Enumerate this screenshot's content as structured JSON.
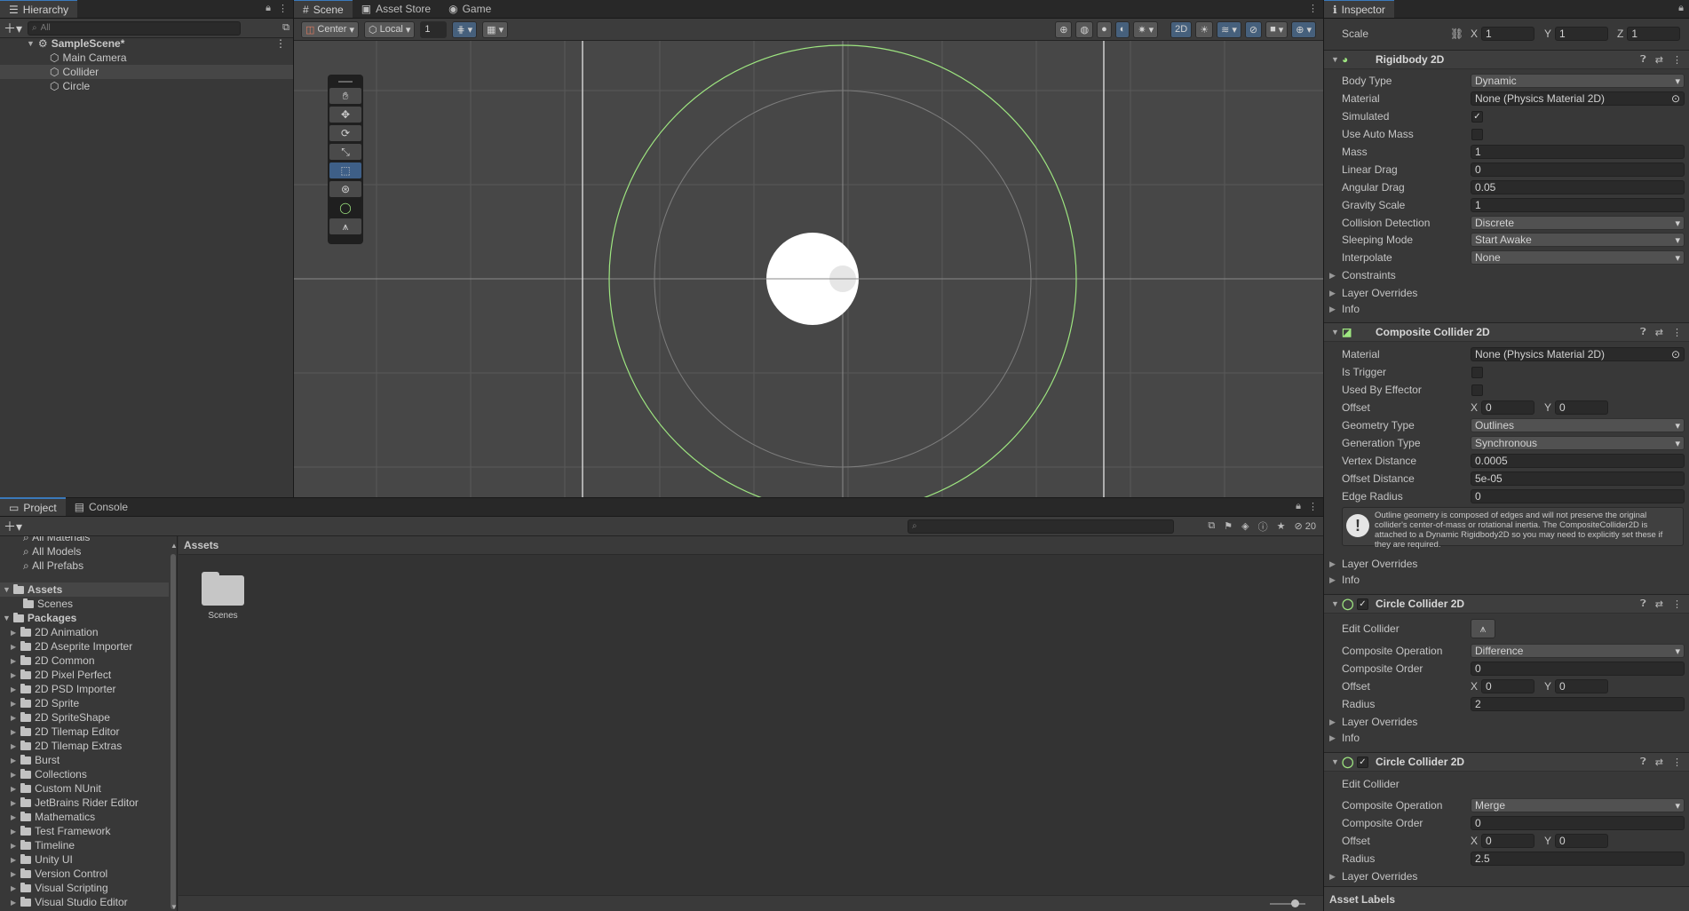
{
  "colors": {
    "accent": "#3a79bb",
    "selection": "#3e5f87",
    "collider_green": "#9ee680",
    "bg": "#383838"
  },
  "hierarchy": {
    "tab": "Hierarchy",
    "search_placeholder": "All",
    "scene_name": "SampleScene*",
    "items": [
      "Main Camera",
      "Collider",
      "Circle"
    ]
  },
  "scene_tabs": {
    "scene": "Scene",
    "asset_store": "Asset Store",
    "game": "Game"
  },
  "scene_toolbar": {
    "pivot": "Center",
    "space": "Local",
    "snap_value": "1",
    "mode_2d": "2D"
  },
  "inspector": {
    "tab": "Inspector",
    "scale": {
      "label": "Scale",
      "x": "1",
      "y": "1",
      "z": "1"
    },
    "rigidbody": {
      "title": "Rigidbody 2D",
      "body_type_label": "Body Type",
      "body_type": "Dynamic",
      "material_label": "Material",
      "material": "None (Physics Material 2D)",
      "simulated_label": "Simulated",
      "use_auto_mass_label": "Use Auto Mass",
      "mass_label": "Mass",
      "mass": "1",
      "linear_drag_label": "Linear Drag",
      "linear_drag": "0",
      "angular_drag_label": "Angular Drag",
      "angular_drag": "0.05",
      "gravity_scale_label": "Gravity Scale",
      "gravity_scale": "1",
      "collision_detection_label": "Collision Detection",
      "collision_detection": "Discrete",
      "sleeping_mode_label": "Sleeping Mode",
      "sleeping_mode": "Start Awake",
      "interpolate_label": "Interpolate",
      "interpolate": "None",
      "constraints": "Constraints",
      "layer_overrides": "Layer Overrides",
      "info": "Info"
    },
    "composite": {
      "title": "Composite Collider 2D",
      "material_label": "Material",
      "material": "None (Physics Material 2D)",
      "is_trigger_label": "Is Trigger",
      "used_by_effector_label": "Used By Effector",
      "offset_label": "Offset",
      "offset_x": "0",
      "offset_y": "0",
      "geometry_type_label": "Geometry Type",
      "geometry_type": "Outlines",
      "generation_type_label": "Generation Type",
      "generation_type": "Synchronous",
      "vertex_distance_label": "Vertex Distance",
      "vertex_distance": "0.0005",
      "offset_distance_label": "Offset Distance",
      "offset_distance": "5e-05",
      "edge_radius_label": "Edge Radius",
      "edge_radius": "0",
      "help": "Outline geometry is composed of edges and will not preserve the original collider's center-of-mass or rotational inertia.  The CompositeCollider2D is attached to a Dynamic Rigidbody2D so you may need to explicitly set these if they are required.",
      "layer_overrides": "Layer Overrides",
      "info": "Info"
    },
    "circle1": {
      "title": "Circle Collider 2D",
      "edit_collider_label": "Edit Collider",
      "composite_operation_label": "Composite Operation",
      "composite_operation": "Difference",
      "composite_order_label": "Composite Order",
      "composite_order": "0",
      "offset_label": "Offset",
      "offset_x": "0",
      "offset_y": "0",
      "radius_label": "Radius",
      "radius": "2",
      "layer_overrides": "Layer Overrides",
      "info": "Info"
    },
    "circle2": {
      "title": "Circle Collider 2D",
      "edit_collider_label": "Edit Collider",
      "composite_operation_label": "Composite Operation",
      "composite_operation": "Merge",
      "composite_order_label": "Composite Order",
      "composite_order": "0",
      "offset_label": "Offset",
      "offset_x": "0",
      "offset_y": "0",
      "radius_label": "Radius",
      "radius": "2.5",
      "layer_overrides": "Layer Overrides"
    },
    "asset_labels": "Asset Labels"
  },
  "project": {
    "tab_project": "Project",
    "tab_console": "Console",
    "hidden_count": "20",
    "favorites": [
      "All Materials",
      "All Models",
      "All Prefabs"
    ],
    "assets_label": "Assets",
    "assets_children": [
      "Scenes"
    ],
    "packages_label": "Packages",
    "packages": [
      "2D Animation",
      "2D Aseprite Importer",
      "2D Common",
      "2D Pixel Perfect",
      "2D PSD Importer",
      "2D Sprite",
      "2D SpriteShape",
      "2D Tilemap Editor",
      "2D Tilemap Extras",
      "Burst",
      "Collections",
      "Custom NUnit",
      "JetBrains Rider Editor",
      "Mathematics",
      "Test Framework",
      "Timeline",
      "Unity UI",
      "Version Control",
      "Visual Scripting",
      "Visual Studio Editor"
    ],
    "breadcrumb": "Assets",
    "grid_items": [
      "Scenes"
    ]
  }
}
